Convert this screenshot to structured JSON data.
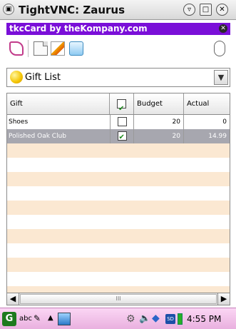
{
  "window": {
    "title": "TightVNC: Zaurus"
  },
  "app": {
    "title": "tkcCard by theKompany.com"
  },
  "combo": {
    "selected": "Gift List"
  },
  "table": {
    "headers": {
      "gift": "Gift",
      "budget": "Budget",
      "actual": "Actual"
    },
    "header_checked": true,
    "rows": [
      {
        "gift": "Shoes",
        "checked": false,
        "budget": "20",
        "actual": "0",
        "selected": false
      },
      {
        "gift": "Polished Oak Club",
        "checked": true,
        "budget": "20",
        "actual": "14.99",
        "selected": true
      }
    ]
  },
  "scrollbar": {
    "thumb_grip": "III"
  },
  "taskbar": {
    "start_label": "G",
    "input_label": "abc",
    "sd_label": "SD",
    "clock": "4:55 PM"
  },
  "icons": {
    "window_menu": "window-menu-icon",
    "toolbar": [
      "book-icon",
      "new-document-icon",
      "edit-pencil-icon",
      "trash-icon",
      "mouse-icon"
    ],
    "combo": "gift-coin-icon",
    "taskbar": [
      "start-icon",
      "pen-icon",
      "up-arrow-icon",
      "app-icon",
      "gear-icon",
      "speaker-icon",
      "network-icon",
      "sd-card-icon",
      "battery-icon"
    ]
  },
  "colors": {
    "app_header": "#7a0fd8",
    "row_odd": "#fbe8d2",
    "row_selected": "#a7a7af",
    "taskbar": "#f0c0e8"
  }
}
